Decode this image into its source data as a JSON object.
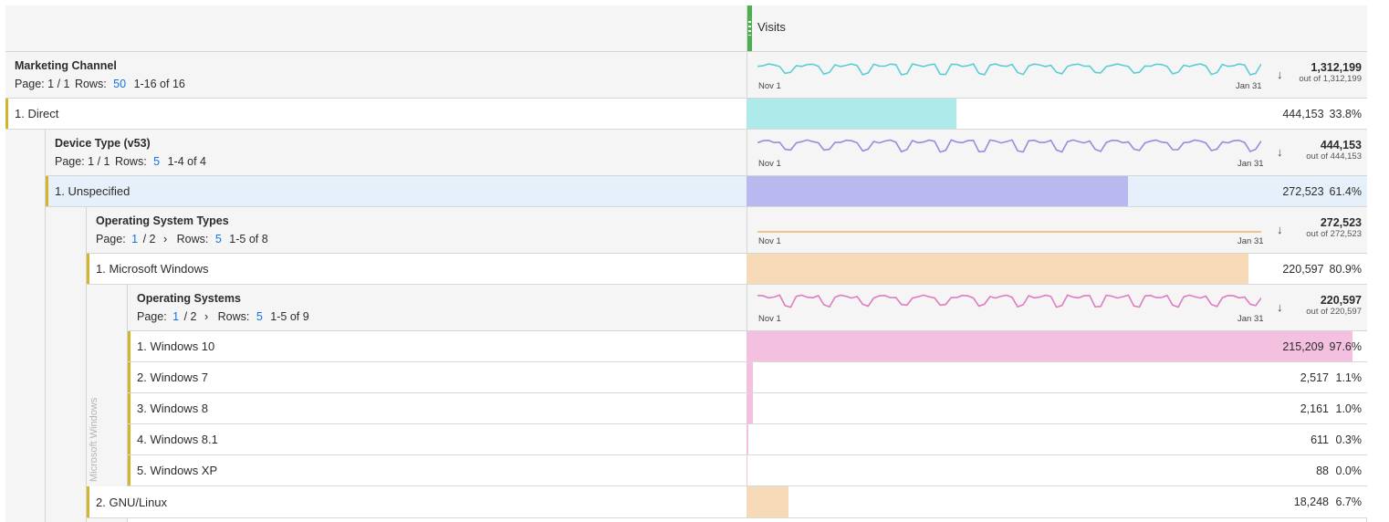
{
  "column_header": {
    "metric": "Visits"
  },
  "level1": {
    "title": "Marketing Channel",
    "page_label": "Page: 1 / 1",
    "rows_label": "Rows:",
    "rows_value": "50",
    "range": "1-16 of 16",
    "spark_start": "Nov 1",
    "spark_end": "Jan 31",
    "total": "1,312,199",
    "out_of": "out of 1,312,199",
    "spark_color": "#5bcdd6"
  },
  "row_direct": {
    "label": "1.  Direct",
    "value": "444,153",
    "pct": "33.8%",
    "fraction": 0.338,
    "color": "#aeeaea"
  },
  "level2": {
    "title": "Device Type (v53)",
    "page_label": "Page: 1 / 1",
    "rows_label": "Rows:",
    "rows_value": "5",
    "range": "1-4 of 4",
    "spark_start": "Nov 1",
    "spark_end": "Jan 31",
    "total": "444,153",
    "out_of": "out of 444,153",
    "spark_color": "#9a8ae0"
  },
  "row_unspecified": {
    "label": "1.  Unspecified",
    "value": "272,523",
    "pct": "61.4%",
    "fraction": 0.614,
    "color": "#b9b9ef"
  },
  "level3": {
    "title": "Operating System Types",
    "page_label": "Page:",
    "page_current": "1",
    "page_total": "/ 2",
    "chevron": "›",
    "rows_label": "Rows:",
    "rows_value": "5",
    "range": "1-5 of 8",
    "spark_start": "Nov 1",
    "spark_end": "Jan 31",
    "total": "272,523",
    "out_of": "out of 272,523",
    "spark_color": "#f0b36a"
  },
  "row_mswin": {
    "label": "1.  Microsoft Windows",
    "value": "220,597",
    "pct": "80.9%",
    "fraction": 0.809,
    "color": "#f7dab8"
  },
  "level4": {
    "title": "Operating Systems",
    "page_label": "Page:",
    "page_current": "1",
    "page_total": "/ 2",
    "chevron": "›",
    "rows_label": "Rows:",
    "rows_value": "5",
    "range": "1-5 of 9",
    "spark_start": "Nov 1",
    "spark_end": "Jan 31",
    "total": "220,597",
    "out_of": "out of 220,597",
    "spark_color": "#e07cc0",
    "side_label": "Microsoft Windows"
  },
  "os_rows": [
    {
      "label": "1.  Windows 10",
      "value": "215,209",
      "pct": "97.6%",
      "fraction": 0.976
    },
    {
      "label": "2.  Windows 7",
      "value": "2,517",
      "pct": "1.1%",
      "fraction": 0.011
    },
    {
      "label": "3.  Windows 8",
      "value": "2,161",
      "pct": "1.0%",
      "fraction": 0.01
    },
    {
      "label": "4.  Windows 8.1",
      "value": "611",
      "pct": "0.3%",
      "fraction": 0.003
    },
    {
      "label": "5.  Windows XP",
      "value": "88",
      "pct": "0.0%",
      "fraction": 0.0
    }
  ],
  "os_color": "#f3c1df",
  "row_linux": {
    "label": "2.  GNU/Linux",
    "value": "18,248",
    "pct": "6.7%",
    "fraction": 0.067,
    "color": "#f7dab8"
  },
  "sort_arrow": "↓"
}
